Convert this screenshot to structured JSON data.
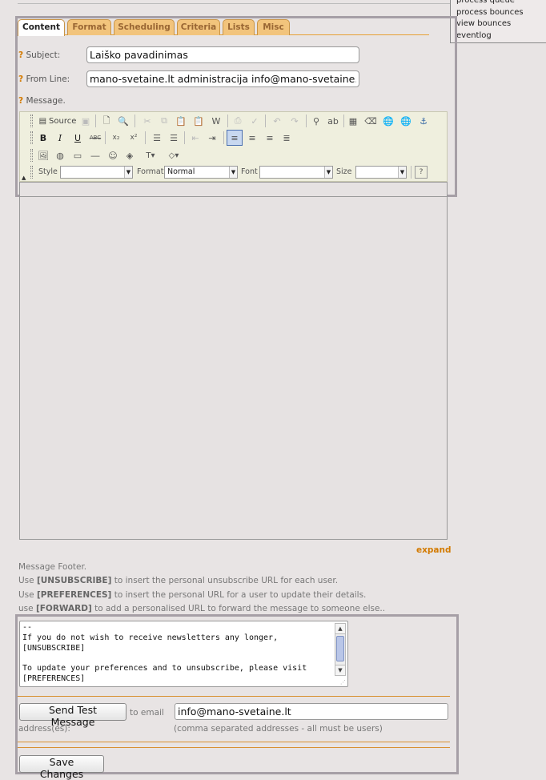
{
  "side_menu": [
    "process queue",
    "process bounces",
    "view bounces",
    "eventlog"
  ],
  "tabs": [
    "Content",
    "Format",
    "Scheduling",
    "Criteria",
    "Lists",
    "Misc"
  ],
  "fields": {
    "qmark": "?",
    "subject_label": "Subject:",
    "subject_value": "Laiško pavadinimas",
    "from_label": "From Line:",
    "from_value": "mano-svetaine.lt administracija info@mano-svetaine.lt",
    "message_label": "Message."
  },
  "toolbar": {
    "source_label": "Source",
    "style_label": "Style",
    "format_label": "Format",
    "format_value": "Normal",
    "font_label": "Font",
    "size_label": "Size",
    "style_value": "",
    "font_value": "",
    "size_value": ""
  },
  "expand_label": "expand",
  "footer_help": {
    "title": "Message Footer.",
    "l1_pre": "Use ",
    "l1_tag": "[UNSUBSCRIBE]",
    "l1_post": " to insert the personal unsubscribe URL for each user.",
    "l2_pre": "Use ",
    "l2_tag": "[PREFERENCES]",
    "l2_post": " to insert the personal URL for a user to update their details.",
    "l3_pre": "use ",
    "l3_tag": "[FORWARD]",
    "l3_post": " to add a personalised URL to forward the message to someone else.."
  },
  "footer_text": "--\nIf you do not wish to receive newsletters any longer,\n[UNSUBSCRIBE]\n\nTo update your preferences and to unsubscribe, please visit\n[PREFERENCES]",
  "test": {
    "button": "Send Test Message",
    "to_email": "to email",
    "addresses": "address(es):",
    "email_value": "info@mano-svetaine.lt",
    "hint": "(comma separated addresses - all must be users)"
  },
  "save_button": "Save Changes"
}
